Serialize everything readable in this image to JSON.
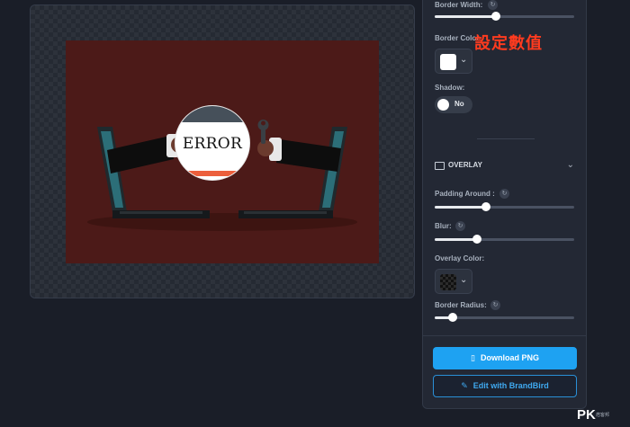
{
  "preview": {
    "badge_text": "ERROR"
  },
  "panel": {
    "border_width_label": "Border Width:",
    "border_width_value": 0.44,
    "border_color_label": "Border Color",
    "border_color": "#ffffff",
    "shadow_label": "Shadow:",
    "shadow_toggle_label": "No",
    "overlay_section_title": "OVERLAY",
    "padding_label": "Padding Around :",
    "padding_value": 0.37,
    "blur_label": "Blur:",
    "blur_value": 0.3,
    "overlay_color_label": "Overlay Color:",
    "border_radius_label": "Border Radius:",
    "border_radius_value": 0.13
  },
  "buttons": {
    "download_label": "Download PNG",
    "edit_label": "Edit with BrandBird"
  },
  "annotation_text": "設定數值",
  "watermark": {
    "logo": "PK",
    "sub": "痞客邦"
  },
  "colors": {
    "accent": "#1ea2f2",
    "preview_bg": "#4c1a18",
    "annotation": "#ff3b1f"
  }
}
